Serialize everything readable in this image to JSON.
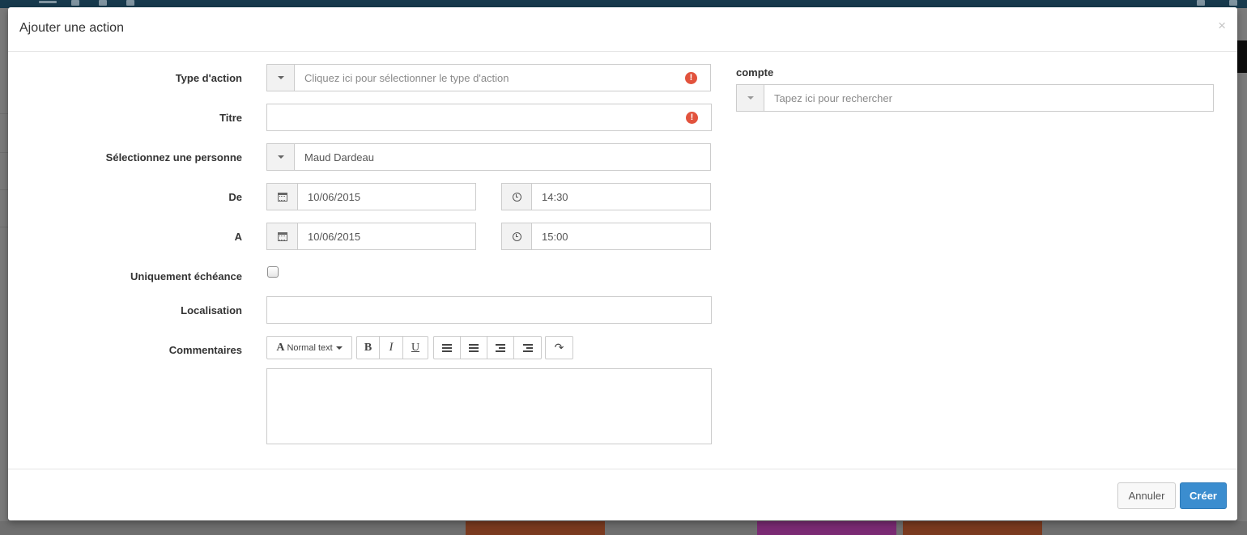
{
  "modal": {
    "title": "Ajouter une action",
    "close_glyph": "×"
  },
  "form": {
    "type_action": {
      "label": "Type d'action",
      "placeholder": "Cliquez ici pour sélectionner le type d'action",
      "error_glyph": "!"
    },
    "titre": {
      "label": "Titre",
      "value": "",
      "error_glyph": "!"
    },
    "personne": {
      "label": "Sélectionnez une personne",
      "value": "Maud Dardeau"
    },
    "de": {
      "label": "De",
      "date": "10/06/2015",
      "time": "14:30"
    },
    "a": {
      "label": "A",
      "date": "10/06/2015",
      "time": "15:00"
    },
    "echeance": {
      "label": "Uniquement échéance",
      "checked": false
    },
    "localisation": {
      "label": "Localisation",
      "value": ""
    },
    "commentaires": {
      "label": "Commentaires",
      "toolbar": {
        "text_style_glyph": "A",
        "text_style": "Normal text",
        "bold": "B",
        "italic": "I",
        "underline": "U",
        "redo_glyph": "↷"
      },
      "value": ""
    },
    "compte": {
      "label": "compte",
      "placeholder": "Tapez ici pour rechercher"
    }
  },
  "footer": {
    "cancel_label": "Annuler",
    "create_label": "Créer"
  },
  "colors": {
    "primary": "#3b8dcf",
    "error": "#e2533d",
    "topbar": "#173a4d"
  }
}
